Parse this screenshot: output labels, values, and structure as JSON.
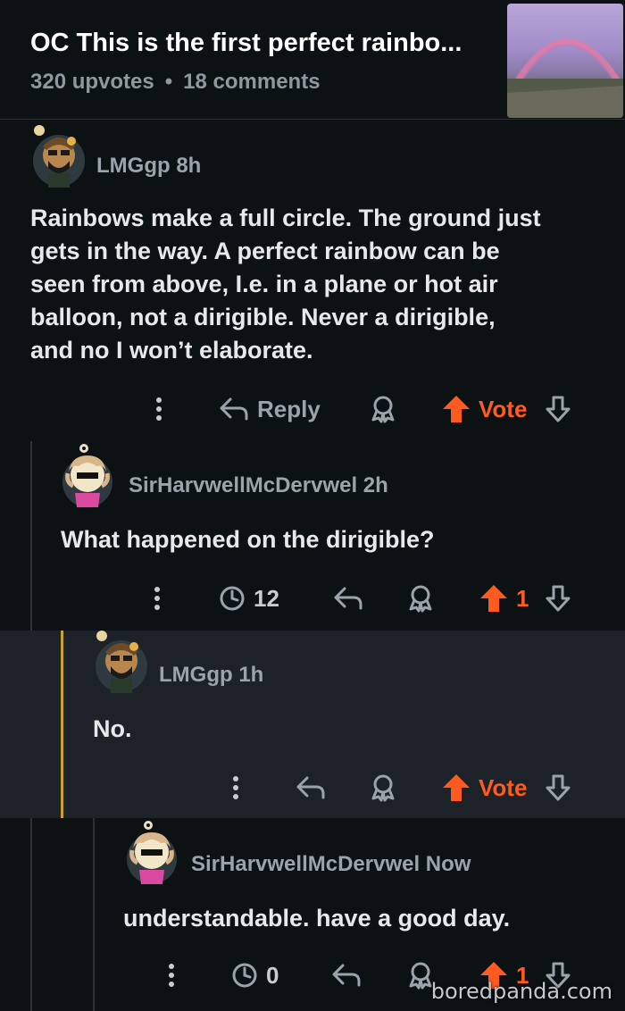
{
  "header": {
    "title": "OC This is the first perfect rainbo...",
    "upvotes": "320 upvotes",
    "separator": "•",
    "comments": "18 comments"
  },
  "comments": [
    {
      "author": "LMGgp",
      "age": "8h",
      "body_lines": [
        "Rainbows make a full circle. The ground just",
        "gets in the way. A perfect rainbow can be",
        "seen from above, I.e. in a plane or hot air",
        "balloon, not a dirigible. Never a dirigible,",
        "and no I won’t elaborate."
      ],
      "reply_label": "Reply",
      "vote_label": "Vote"
    },
    {
      "author": "SirHarvwellMcDervwel",
      "age": "2h",
      "body": "What happened on the dirigible?",
      "awards": "12",
      "score": "1"
    },
    {
      "author": "LMGgp",
      "age": "1h",
      "body": "No.",
      "vote_label": "Vote"
    },
    {
      "author": "SirHarvwellMcDervwel",
      "age": "Now",
      "body": "understandable. have a good day.",
      "awards": "0",
      "score": "1"
    }
  ],
  "watermark": "boredpanda.com",
  "colors": {
    "accent": "#ff5a1f",
    "highlight": "#c9a227",
    "background": "#0c1114"
  }
}
